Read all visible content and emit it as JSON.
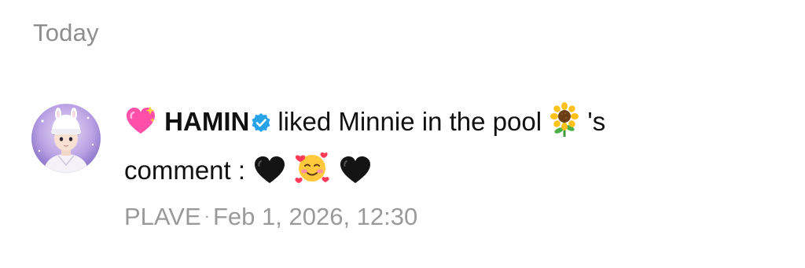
{
  "section": {
    "header": "Today"
  },
  "notification": {
    "username": "HAMIN",
    "action_text": "liked Minnie in the pool",
    "possessive": "'s",
    "comment_prefix": "comment :",
    "source": "PLAVE",
    "separator": "·",
    "timestamp": "Feb 1, 2026, 12:30",
    "icons": {
      "leading": "sparkling-heart-icon",
      "verified": "verified-badge-icon",
      "name_suffix": "sunflower-icon",
      "comment_emojis": [
        "black-heart-icon",
        "smiling-face-with-hearts-icon",
        "black-heart-icon"
      ]
    }
  },
  "colors": {
    "header_gray": "#8e8e8e",
    "meta_gray": "#9a9a9a",
    "verified_blue": "#27a3e8",
    "heart_pink": "#ff4fa8"
  }
}
